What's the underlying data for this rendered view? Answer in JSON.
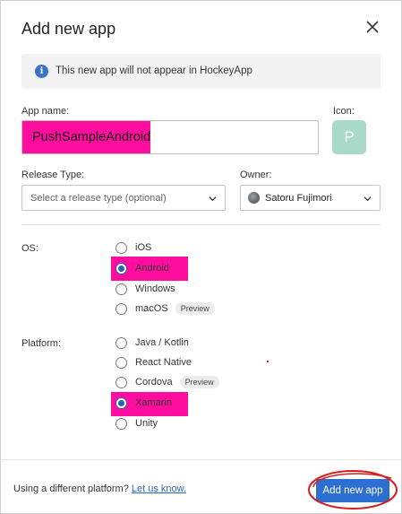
{
  "dialog": {
    "title": "Add new app",
    "notice": "This new app will not appear in HockeyApp"
  },
  "form": {
    "app_name_label": "App name:",
    "app_name_value": "PushSampleAndroid",
    "icon_label": "Icon:",
    "icon_letter": "P",
    "release_type_label": "Release Type:",
    "release_type_placeholder": "Select a release type (optional)",
    "owner_label": "Owner:",
    "owner_value": "Satoru Fujimori"
  },
  "os": {
    "label": "OS:",
    "options": [
      {
        "label": "iOS",
        "selected": false,
        "badge": ""
      },
      {
        "label": "Android",
        "selected": true,
        "badge": ""
      },
      {
        "label": "Windows",
        "selected": false,
        "badge": ""
      },
      {
        "label": "macOS",
        "selected": false,
        "badge": "Preview"
      }
    ]
  },
  "platform": {
    "label": "Platform:",
    "options": [
      {
        "label": "Java / Kotlin",
        "selected": false,
        "badge": ""
      },
      {
        "label": "React Native",
        "selected": false,
        "badge": ""
      },
      {
        "label": "Cordova",
        "selected": false,
        "badge": "Preview"
      },
      {
        "label": "Xamarin",
        "selected": true,
        "badge": ""
      },
      {
        "label": "Unity",
        "selected": false,
        "badge": ""
      }
    ]
  },
  "footer": {
    "prompt": "Using a different platform?",
    "link": "Let us know.",
    "add_button": "Add new app"
  },
  "colors": {
    "highlight": "#ff0d9e",
    "primary": "#2d6fd1",
    "icon_tile": "#a9dac9",
    "annotation": "#d42020"
  }
}
